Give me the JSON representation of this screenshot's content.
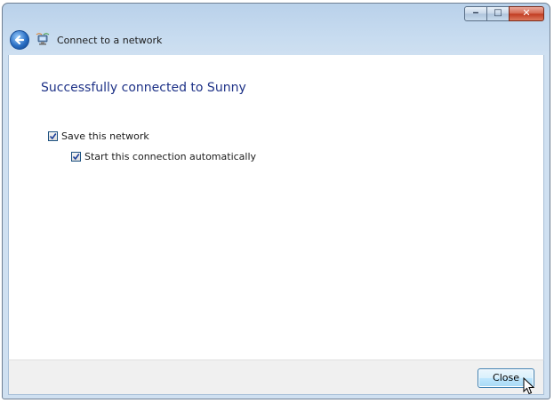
{
  "window": {
    "title": "Connect to a network",
    "caption_buttons": {
      "minimize_icon": "minimize-icon",
      "maximize_icon": "maximize-icon",
      "close_icon": "close-icon"
    },
    "back_icon": "back-arrow-icon",
    "app_icon": "network-icon"
  },
  "main": {
    "heading": "Successfully connected to Sunny",
    "options": [
      {
        "label": "Save this network",
        "checked": true
      },
      {
        "label": "Start this connection automatically",
        "checked": true
      }
    ]
  },
  "footer": {
    "close_label": "Close"
  },
  "colors": {
    "heading": "#1e3287",
    "accent": "#3c7fb1"
  }
}
